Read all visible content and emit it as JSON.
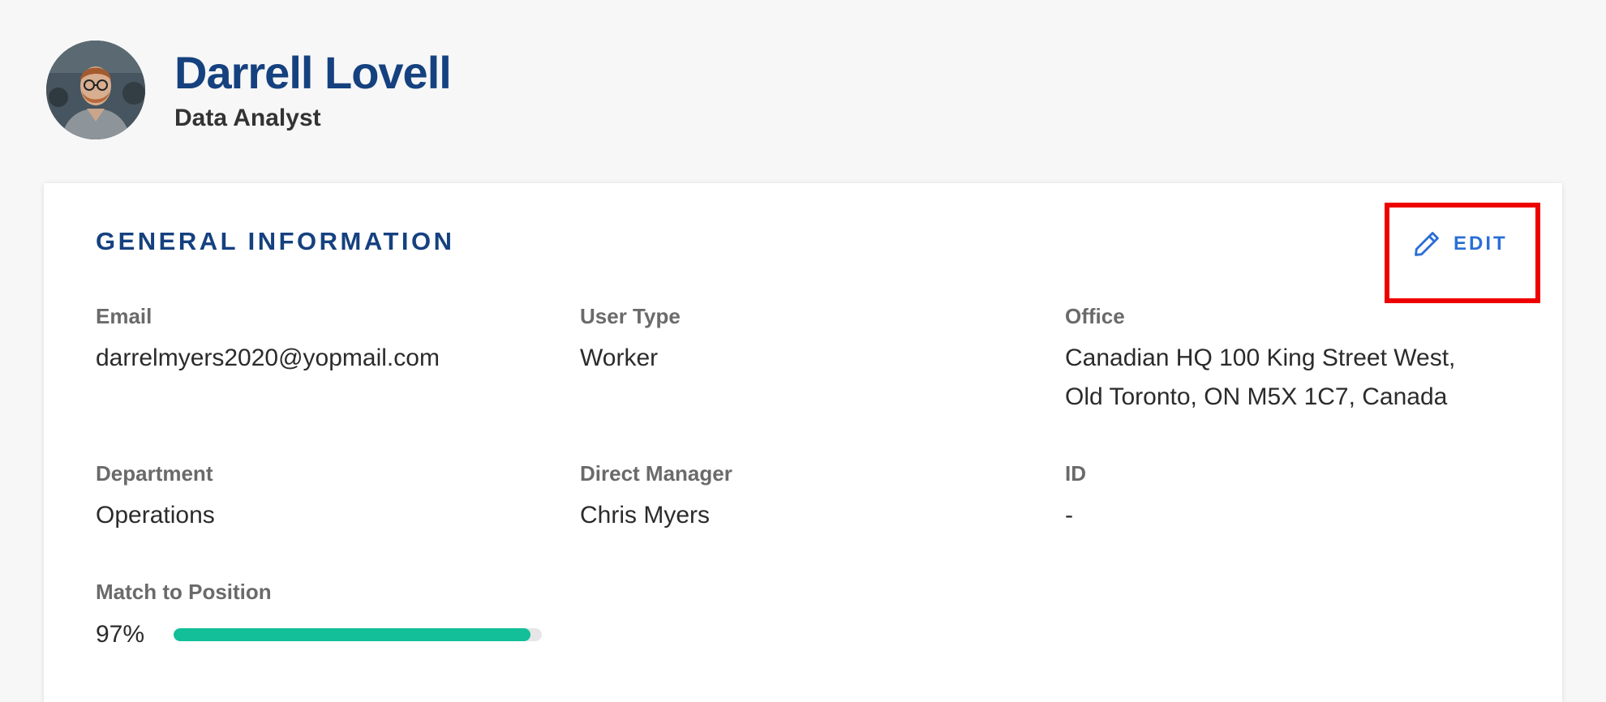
{
  "profile": {
    "name": "Darrell Lovell",
    "job_title": "Data Analyst"
  },
  "general_info": {
    "section_title": "GENERAL INFORMATION",
    "edit_label": "EDIT",
    "edit_icon": "pencil-icon",
    "fields": {
      "email": {
        "label": "Email",
        "value": "darrelmyers2020@yopmail.com"
      },
      "user_type": {
        "label": "User Type",
        "value": "Worker"
      },
      "office": {
        "label": "Office",
        "value_line1": "Canadian HQ 100 King Street West,",
        "value_line2": "Old Toronto, ON M5X 1C7, Canada"
      },
      "department": {
        "label": "Department",
        "value": "Operations"
      },
      "direct_manager": {
        "label": "Direct Manager",
        "value": "Chris Myers"
      },
      "id": {
        "label": "ID",
        "value": "-"
      }
    },
    "match": {
      "label": "Match to Position",
      "value_text": "97%",
      "percent": 97
    }
  },
  "colors": {
    "accent_blue": "#15417f",
    "edit_blue": "#2a6fd6",
    "progress_green": "#12bf98",
    "highlight_red": "#ee0000"
  }
}
